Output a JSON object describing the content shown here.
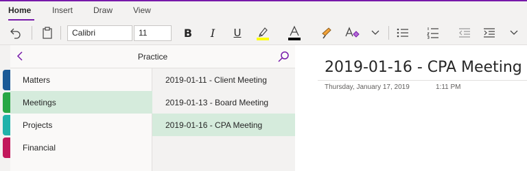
{
  "ribbon": {
    "tabs": [
      {
        "label": "Home",
        "active": true
      },
      {
        "label": "Insert",
        "active": false
      },
      {
        "label": "Draw",
        "active": false
      },
      {
        "label": "View",
        "active": false
      }
    ]
  },
  "toolbar": {
    "font_name": "Calibri",
    "font_size": "11",
    "bold_label": "B",
    "italic_label": "I",
    "underline_label": "U",
    "highlight_color": "#ffff00",
    "font_color": "#000000",
    "icons": [
      "undo-icon",
      "clipboard-icon",
      "bold-icon",
      "italic-icon",
      "underline-icon",
      "highlighter-icon",
      "font-color-icon",
      "format-painter-icon",
      "clear-formatting-icon",
      "chevron-down-icon",
      "bullets-icon",
      "numbering-icon",
      "outdent-icon",
      "indent-icon",
      "more-chevron-icon"
    ]
  },
  "navigation": {
    "title": "Practice",
    "sections": [
      {
        "label": "Matters",
        "color": "#1b5a96",
        "selected": false
      },
      {
        "label": "Meetings",
        "color": "#28a745",
        "selected": true
      },
      {
        "label": "Projects",
        "color": "#20b2aa",
        "selected": false
      },
      {
        "label": "Financial",
        "color": "#c2185b",
        "selected": false
      }
    ],
    "pages": [
      {
        "label": "2019-01-11 - Client Meeting",
        "selected": false
      },
      {
        "label": "2019-01-13 - Board Meeting",
        "selected": false
      },
      {
        "label": "2019-01-16 - CPA Meeting",
        "selected": true
      }
    ]
  },
  "page": {
    "title": "2019-01-16 - CPA Meeting",
    "date": "Thursday, January 17, 2019",
    "time": "1:11 PM"
  },
  "colors": {
    "accent": "#7719aa",
    "selection": "#d5ebdc"
  }
}
